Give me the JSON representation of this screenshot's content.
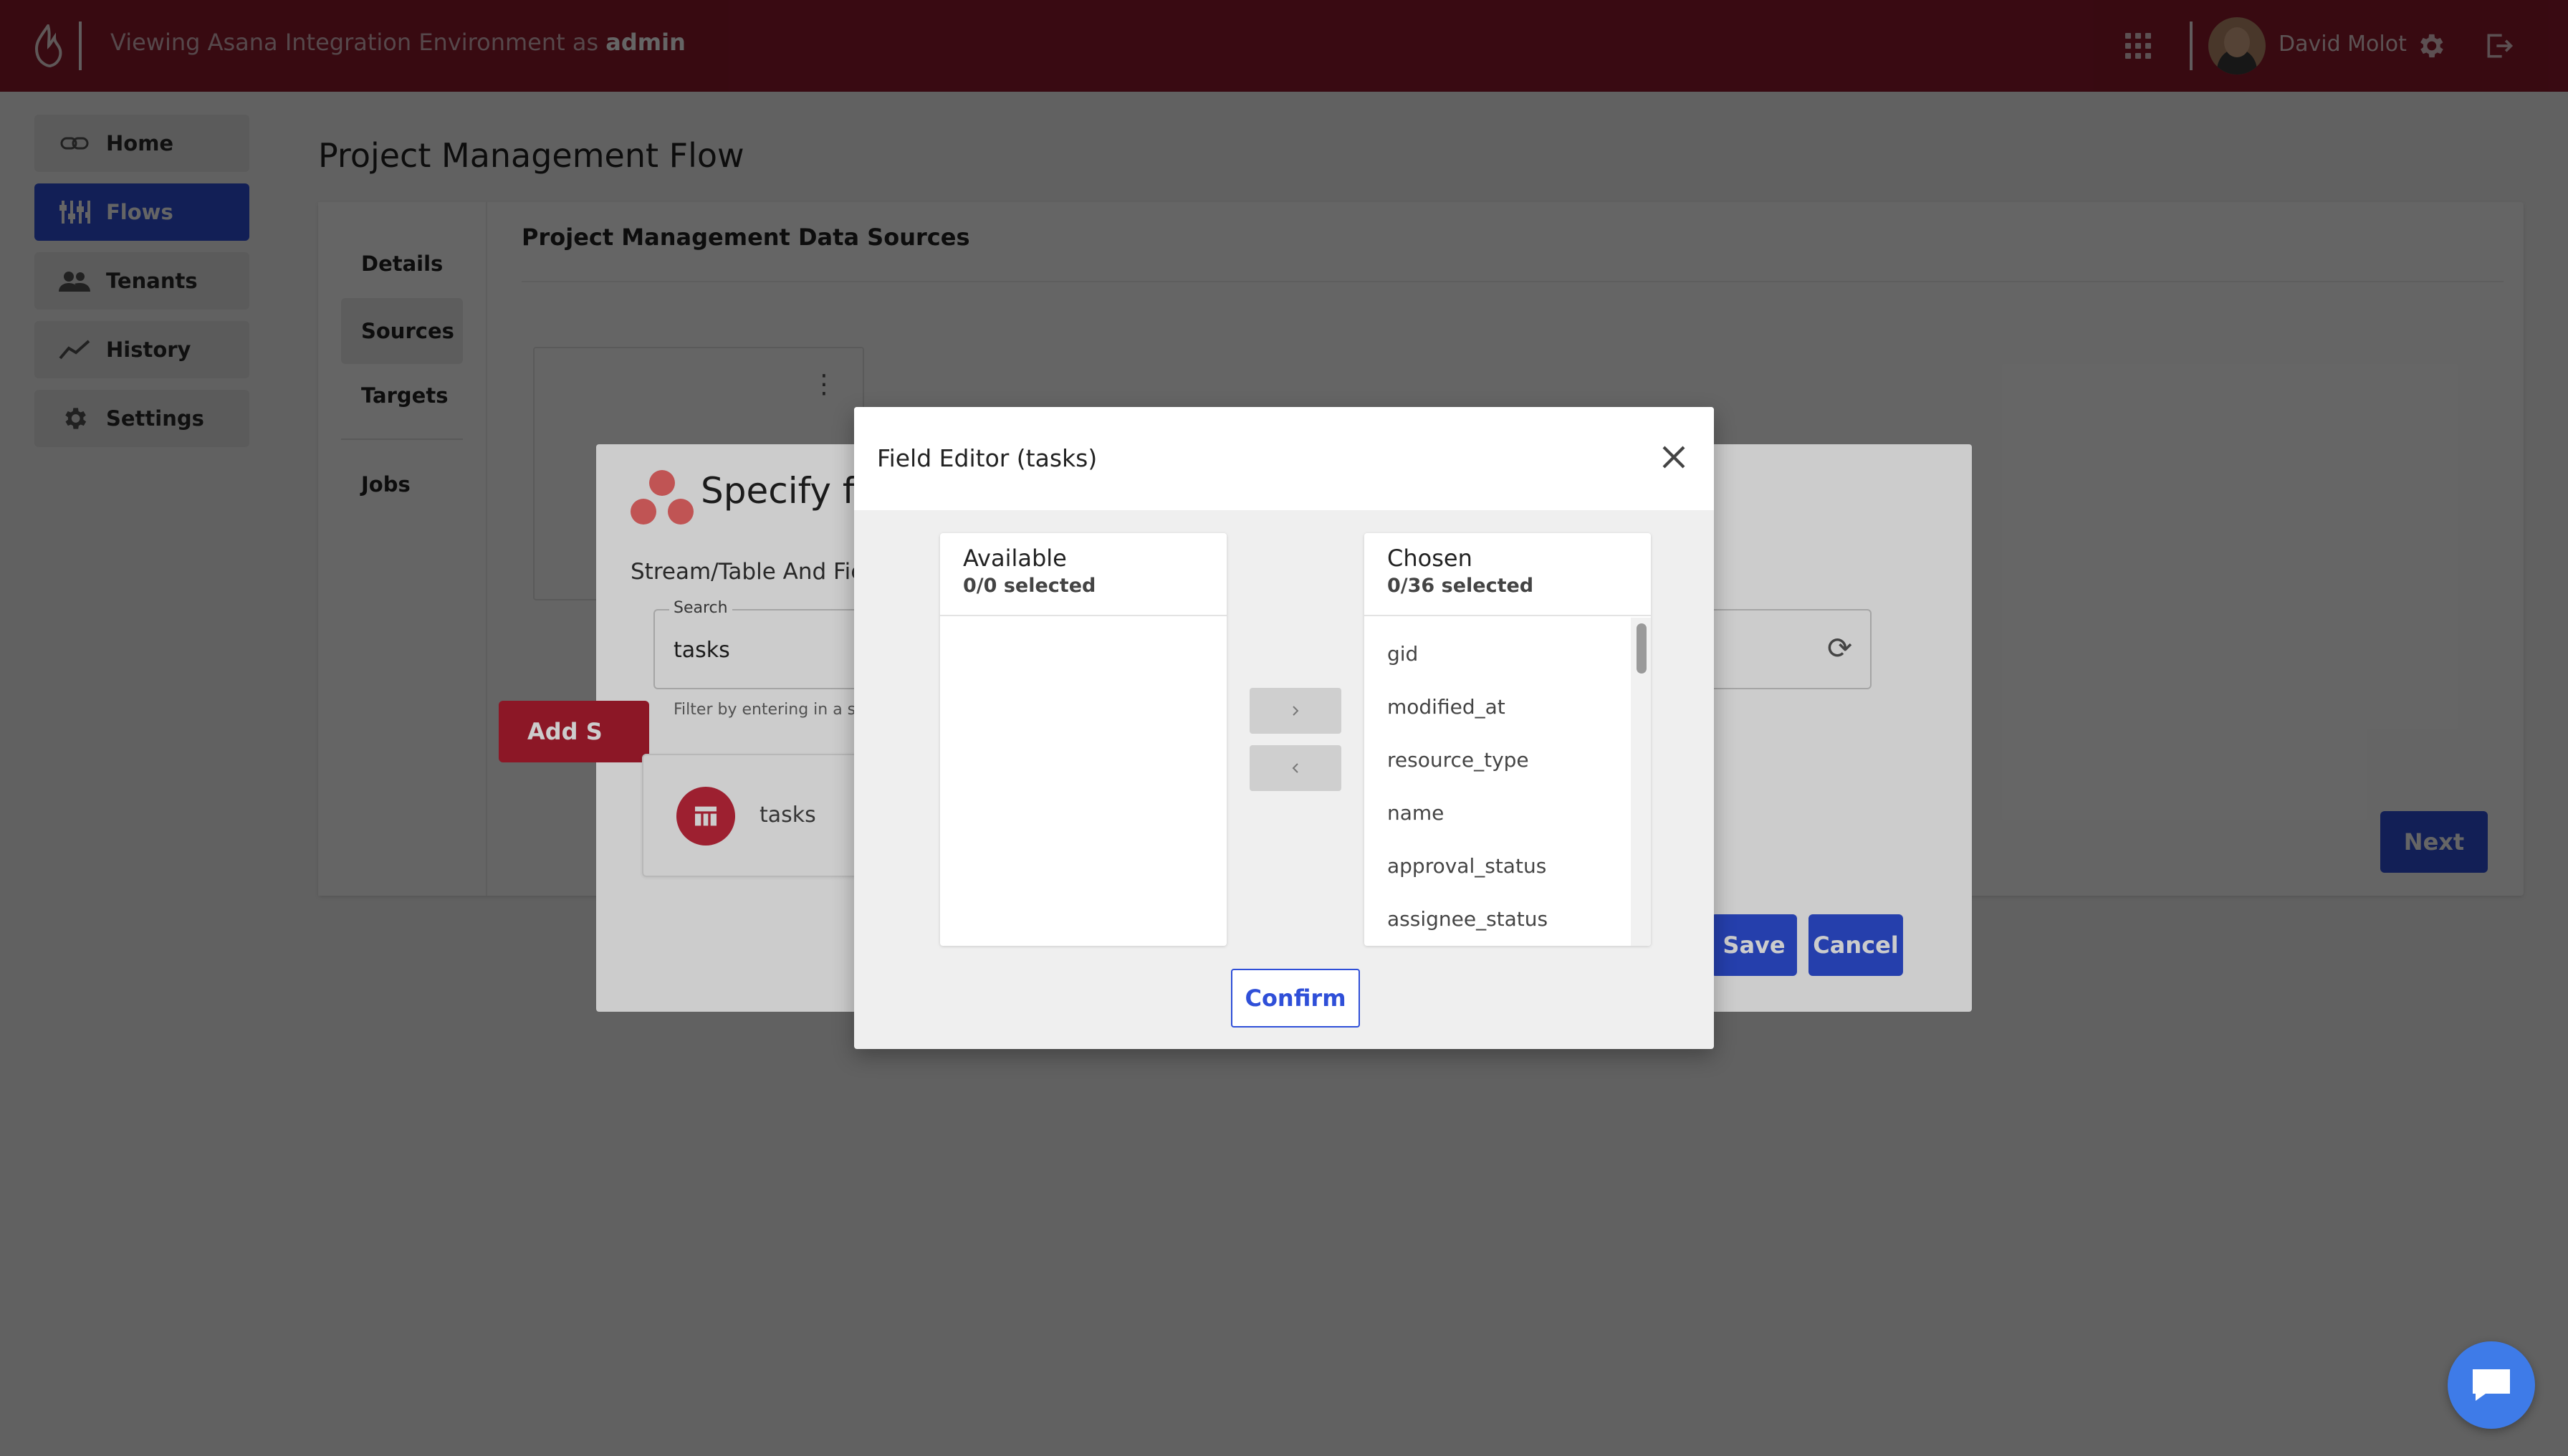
{
  "topbar": {
    "viewing_prefix": "Viewing Asana Integration Environment as",
    "viewing_role": "admin",
    "user_name": "David Molot"
  },
  "sidebar": {
    "items": [
      {
        "label": "Home",
        "icon": "link-icon"
      },
      {
        "label": "Flows",
        "icon": "flows-icon",
        "active": true
      },
      {
        "label": "Tenants",
        "icon": "people-icon"
      },
      {
        "label": "History",
        "icon": "chart-line-icon"
      },
      {
        "label": "Settings",
        "icon": "gear-icon"
      }
    ]
  },
  "page": {
    "title": "Project Management Flow",
    "tabs": [
      "Details",
      "Sources",
      "Targets",
      "Jobs"
    ],
    "selected_tab": "Sources",
    "section_title": "Project Management Data Sources",
    "next_label": "Next"
  },
  "specify_dialog": {
    "title": "Specify fie",
    "subtitle": "Stream/Table And Fie",
    "search_label": "Search",
    "search_value": "tasks",
    "helper_text": "Filter by entering in a st",
    "add_label": "Add S",
    "row_name": "tasks",
    "save_label": "Save",
    "cancel_label": "Cancel"
  },
  "field_editor": {
    "title": "Field Editor (tasks)",
    "available": {
      "title": "Available",
      "count": "0/0 selected",
      "items": []
    },
    "chosen": {
      "title": "Chosen",
      "count": "0/36 selected",
      "items": [
        "gid",
        "modified_at",
        "resource_type",
        "name",
        "approval_status",
        "assignee_status"
      ]
    },
    "confirm_label": "Confirm"
  },
  "colors": {
    "brand_red": "#8e1a2c",
    "accent_blue": "#2f4fd8",
    "asana_red": "#c5283d"
  }
}
